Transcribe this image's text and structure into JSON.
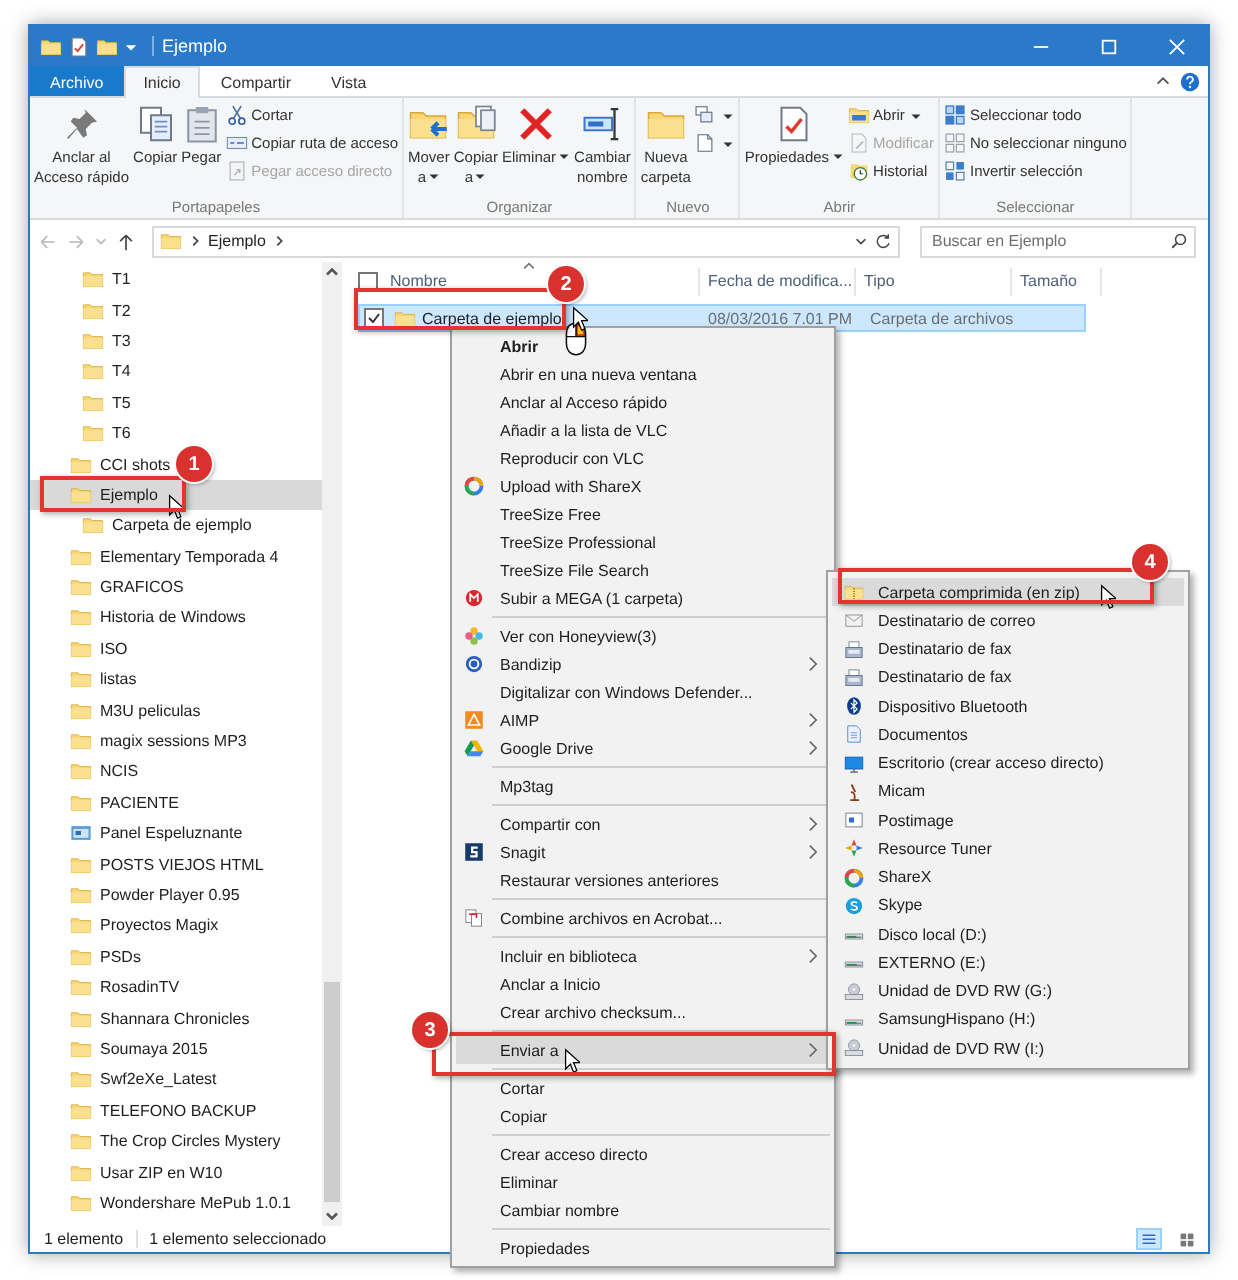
{
  "window": {
    "title": "Ejemplo"
  },
  "ribbon_tabs": [
    {
      "label": "Archivo",
      "kind": "file",
      "selected": false
    },
    {
      "label": "Inicio",
      "kind": "tab",
      "selected": true
    },
    {
      "label": "Compartir",
      "kind": "tab",
      "selected": false
    },
    {
      "label": "Vista",
      "kind": "tab",
      "selected": false
    }
  ],
  "ribbon": {
    "groups": [
      {
        "label": "Portapapeles",
        "buttons": [
          {
            "kind": "large",
            "label": "Anclar al\nAcceso rápido",
            "dropdown": false,
            "disabled": false
          },
          {
            "kind": "large",
            "label": "Copiar",
            "dropdown": false,
            "disabled": false
          },
          {
            "kind": "large",
            "label": "Pegar",
            "dropdown": false,
            "disabled": false
          },
          {
            "kind": "small",
            "label": "Cortar",
            "dropdown": false,
            "disabled": false
          },
          {
            "kind": "small",
            "label": "Copiar ruta de acceso",
            "dropdown": false,
            "disabled": false
          },
          {
            "kind": "small",
            "label": "Pegar acceso directo",
            "dropdown": false,
            "disabled": true
          }
        ]
      },
      {
        "label": "Organizar",
        "buttons": [
          {
            "kind": "large",
            "label": "Mover\na",
            "dropdown": true,
            "disabled": false
          },
          {
            "kind": "large",
            "label": "Copiar\na",
            "dropdown": true,
            "disabled": false
          },
          {
            "kind": "large",
            "label": "Eliminar",
            "dropdown": true,
            "disabled": false
          },
          {
            "kind": "large",
            "label": "Cambiar\nnombre",
            "dropdown": false,
            "disabled": false
          }
        ]
      },
      {
        "label": "Nuevo",
        "buttons": [
          {
            "kind": "large",
            "label": "Nueva\ncarpeta",
            "dropdown": false,
            "disabled": false
          },
          {
            "kind": "icon",
            "dropdown": true,
            "disabled": false
          },
          {
            "kind": "icon",
            "dropdown": true,
            "disabled": false
          }
        ]
      },
      {
        "label": "Abrir",
        "buttons": [
          {
            "kind": "large",
            "label": "Propiedades",
            "dropdown": true,
            "disabled": false
          },
          {
            "kind": "small",
            "label": "Abrir",
            "dropdown": true,
            "disabled": false
          },
          {
            "kind": "small",
            "label": "Modificar",
            "dropdown": false,
            "disabled": true
          },
          {
            "kind": "small",
            "label": "Historial",
            "dropdown": false,
            "disabled": false
          }
        ]
      },
      {
        "label": "Seleccionar",
        "buttons": [
          {
            "kind": "small",
            "label": "Seleccionar todo",
            "dropdown": false,
            "disabled": false
          },
          {
            "kind": "small",
            "label": "No seleccionar ninguno",
            "dropdown": false,
            "disabled": false
          },
          {
            "kind": "small",
            "label": "Invertir selección",
            "dropdown": false,
            "disabled": false
          }
        ]
      }
    ]
  },
  "address_bar": {
    "path": [
      "Ejemplo"
    ],
    "search": {
      "placeholder": "Buscar en Ejemplo"
    }
  },
  "nav_pane": {
    "items": [
      {
        "children": [
          {
            "label": "T1",
            "kind": "folder",
            "selected": false
          },
          {
            "label": "T2",
            "kind": "folder",
            "selected": false
          },
          {
            "label": "T3",
            "kind": "folder",
            "selected": false
          },
          {
            "label": "T4",
            "kind": "folder",
            "selected": false
          },
          {
            "label": "T5",
            "kind": "folder",
            "selected": false
          },
          {
            "label": "T6",
            "kind": "folder",
            "selected": false
          }
        ]
      },
      {
        "label": "CCI shots",
        "kind": "folder",
        "selected": false
      },
      {
        "label": "Ejemplo",
        "kind": "folder",
        "selected": true,
        "children": [
          {
            "label": "Carpeta de ejemplo",
            "kind": "folder",
            "selected": false
          }
        ]
      },
      {
        "label": "Elementary Temporada 4",
        "kind": "folder",
        "selected": false
      },
      {
        "label": "GRAFICOS",
        "kind": "folder",
        "selected": false
      },
      {
        "label": "Historia de Windows",
        "kind": "folder",
        "selected": false
      },
      {
        "label": "ISO",
        "kind": "folder",
        "selected": false
      },
      {
        "label": "listas",
        "kind": "folder",
        "selected": false
      },
      {
        "label": "M3U peliculas",
        "kind": "folder",
        "selected": false
      },
      {
        "label": "magix sessions MP3",
        "kind": "folder",
        "selected": false
      },
      {
        "label": "NCIS",
        "kind": "folder",
        "selected": false
      },
      {
        "label": "PACIENTE",
        "kind": "folder",
        "selected": false
      },
      {
        "label": "Panel Espeluznante",
        "kind": "app-folder",
        "selected": false
      },
      {
        "label": "POSTS VIEJOS HTML",
        "kind": "folder",
        "selected": false
      },
      {
        "label": "Powder Player 0.95",
        "kind": "folder",
        "selected": false
      },
      {
        "label": "Proyectos Magix",
        "kind": "folder",
        "selected": false
      },
      {
        "label": "PSDs",
        "kind": "folder",
        "selected": false
      },
      {
        "label": "RosadinTV",
        "kind": "folder",
        "selected": false
      },
      {
        "label": "Shannara Chronicles",
        "kind": "folder",
        "selected": false
      },
      {
        "label": "Soumaya 2015",
        "kind": "folder",
        "selected": false
      },
      {
        "label": "Swf2eXe_Latest",
        "kind": "folder",
        "selected": false
      },
      {
        "label": "TELEFONO BACKUP",
        "kind": "folder",
        "selected": false
      },
      {
        "label": "The Crop Circles Mystery",
        "kind": "folder",
        "selected": false
      },
      {
        "label": "Usar ZIP en W10",
        "kind": "folder",
        "selected": false
      },
      {
        "label": "Wondershare MePub 1.0.1",
        "kind": "folder",
        "selected": false
      }
    ]
  },
  "file_list": {
    "header_checkbox": {
      "checked": false
    },
    "columns": [
      "Nombre",
      "Fecha de modifica...",
      "Tipo",
      "Tamaño"
    ],
    "rows": [
      {
        "cells": [
          "Carpeta de ejemplo",
          "08/03/2016 7.01 PM",
          "Carpeta de archivos"
        ],
        "selected": true,
        "checked": true
      }
    ]
  },
  "context_menu": {
    "items": [
      {
        "kind": "item",
        "label": "Abrir",
        "default": true,
        "submenu": false,
        "selected": false
      },
      {
        "kind": "item",
        "label": "Abrir en una nueva ventana",
        "default": false,
        "submenu": false,
        "selected": false
      },
      {
        "kind": "item",
        "label": "Anclar al Acceso rápido",
        "default": false,
        "submenu": false,
        "selected": false
      },
      {
        "kind": "item",
        "label": "Añadir a la lista de VLC",
        "default": false,
        "submenu": false,
        "selected": false
      },
      {
        "kind": "item",
        "label": "Reproducir con VLC",
        "default": false,
        "submenu": false,
        "selected": false
      },
      {
        "kind": "item",
        "label": "Upload with ShareX",
        "default": false,
        "submenu": false,
        "selected": false
      },
      {
        "kind": "item",
        "label": "TreeSize Free",
        "default": false,
        "submenu": false,
        "selected": false
      },
      {
        "kind": "item",
        "label": "TreeSize Professional",
        "default": false,
        "submenu": false,
        "selected": false
      },
      {
        "kind": "item",
        "label": "TreeSize File Search",
        "default": false,
        "submenu": false,
        "selected": false
      },
      {
        "kind": "item",
        "label": "Subir a MEGA (1 carpeta)",
        "default": false,
        "submenu": false,
        "selected": false
      },
      {
        "kind": "separator"
      },
      {
        "kind": "item",
        "label": "Ver con Honeyview(3)",
        "default": false,
        "submenu": false,
        "selected": false
      },
      {
        "kind": "item",
        "label": "Bandizip",
        "default": false,
        "submenu": true,
        "selected": false
      },
      {
        "kind": "item",
        "label": "Digitalizar con Windows Defender...",
        "default": false,
        "submenu": false,
        "selected": false
      },
      {
        "kind": "item",
        "label": "AIMP",
        "default": false,
        "submenu": true,
        "selected": false
      },
      {
        "kind": "item",
        "label": "Google Drive",
        "default": false,
        "submenu": true,
        "selected": false
      },
      {
        "kind": "separator"
      },
      {
        "kind": "item",
        "label": "Mp3tag",
        "default": false,
        "submenu": false,
        "selected": false
      },
      {
        "kind": "separator"
      },
      {
        "kind": "item",
        "label": "Compartir con",
        "default": false,
        "submenu": true,
        "selected": false
      },
      {
        "kind": "item",
        "label": "Snagit",
        "default": false,
        "submenu": true,
        "selected": false
      },
      {
        "kind": "item",
        "label": "Restaurar versiones anteriores",
        "default": false,
        "submenu": false,
        "selected": false
      },
      {
        "kind": "separator"
      },
      {
        "kind": "item",
        "label": "Combine archivos en Acrobat...",
        "default": false,
        "submenu": false,
        "selected": false
      },
      {
        "kind": "separator"
      },
      {
        "kind": "item",
        "label": "Incluir en biblioteca",
        "default": false,
        "submenu": true,
        "selected": false
      },
      {
        "kind": "item",
        "label": "Anclar a Inicio",
        "default": false,
        "submenu": false,
        "selected": false
      },
      {
        "kind": "item",
        "label": "Crear archivo checksum...",
        "default": false,
        "submenu": false,
        "selected": false
      },
      {
        "kind": "separator"
      },
      {
        "kind": "item",
        "label": "Enviar a",
        "default": false,
        "submenu": true,
        "selected": true
      },
      {
        "kind": "separator"
      },
      {
        "kind": "item",
        "label": "Cortar",
        "default": false,
        "submenu": false,
        "selected": false
      },
      {
        "kind": "item",
        "label": "Copiar",
        "default": false,
        "submenu": false,
        "selected": false
      },
      {
        "kind": "separator"
      },
      {
        "kind": "item",
        "label": "Crear acceso directo",
        "default": false,
        "submenu": false,
        "selected": false
      },
      {
        "kind": "item",
        "label": "Eliminar",
        "default": false,
        "submenu": false,
        "selected": false
      },
      {
        "kind": "item",
        "label": "Cambiar nombre",
        "default": false,
        "submenu": false,
        "selected": false
      },
      {
        "kind": "separator"
      },
      {
        "kind": "item",
        "label": "Propiedades",
        "default": false,
        "submenu": false,
        "selected": false
      }
    ]
  },
  "send_to_menu": {
    "items": [
      {
        "label": "Carpeta comprimida (en zip)",
        "selected": true
      },
      {
        "label": "Destinatario de correo",
        "selected": false
      },
      {
        "label": "Destinatario de fax",
        "selected": false
      },
      {
        "label": "Destinatario de fax",
        "selected": false
      },
      {
        "label": "Dispositivo Bluetooth",
        "selected": false
      },
      {
        "label": "Documentos",
        "selected": false
      },
      {
        "label": "Escritorio (crear acceso directo)",
        "selected": false
      },
      {
        "label": "Micam",
        "selected": false
      },
      {
        "label": "Postimage",
        "selected": false
      },
      {
        "label": "Resource Tuner",
        "selected": false
      },
      {
        "label": "ShareX",
        "selected": false
      },
      {
        "label": "Skype",
        "selected": false
      },
      {
        "label": "Disco local (D:)",
        "selected": false
      },
      {
        "label": "EXTERNO (E:)",
        "selected": false
      },
      {
        "label": "Unidad de DVD RW (G:)",
        "selected": false
      },
      {
        "label": "SamsungHispano (H:)",
        "selected": false
      },
      {
        "label": "Unidad de DVD RW (I:)",
        "selected": false
      }
    ]
  },
  "callouts": [
    {
      "number": "1"
    },
    {
      "number": "2"
    },
    {
      "number": "3"
    },
    {
      "number": "4"
    }
  ],
  "status_bar": {
    "count": "1 elemento",
    "selection": "1 elemento seleccionado",
    "view_buttons": [
      {
        "kind": "details",
        "selected": true
      },
      {
        "kind": "tiles",
        "selected": false
      }
    ]
  }
}
